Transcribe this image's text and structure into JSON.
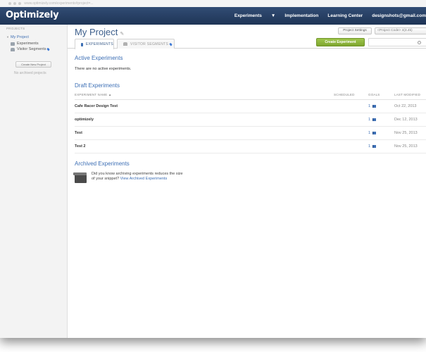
{
  "browser": {
    "url": "www.optimizely.com/experiments#project=..."
  },
  "topnav": {
    "logo": "Optimizely",
    "links": [
      "Experiments",
      "Implementation",
      "Learning Center",
      "designshots@gmail.com"
    ]
  },
  "sidebar": {
    "heading": "PROJECTS",
    "project": "My Project",
    "items": [
      "Experiments",
      "Visitor Segments"
    ],
    "create_button": "Create New Project",
    "no_archived": "No archived projects"
  },
  "header": {
    "title": "My Project",
    "settings_button": "Project Settings",
    "code_button": "<Project Code>  4(3.4k)"
  },
  "tabs": [
    {
      "label": "EXPERIMENTS"
    },
    {
      "label": "VISITOR SEGMENTS"
    }
  ],
  "create_experiment_button": "Create Experiment",
  "active": {
    "title": "Active Experiments",
    "empty": "There are no active experiments."
  },
  "draft": {
    "title": "Draft Experiments",
    "columns": [
      "EXPERIMENT NAME ▲",
      "SCHEDULED",
      "GOALS",
      "LAST MODIFIED"
    ],
    "rows": [
      {
        "name": "Cafe Racer Design Test",
        "goals": "1",
        "date": "Oct 22, 2013"
      },
      {
        "name": "optimizely",
        "goals": "1",
        "date": "Dec 12, 2013"
      },
      {
        "name": "Test",
        "goals": "1",
        "date": "Nov 25, 2013"
      },
      {
        "name": "Test 2",
        "goals": "1",
        "date": "Nov 25, 2013"
      }
    ]
  },
  "archived": {
    "title": "Archived Experiments",
    "text": "Did you know archiving experiments reduces the size of your snippet?",
    "link": "View Archived Experiments"
  }
}
